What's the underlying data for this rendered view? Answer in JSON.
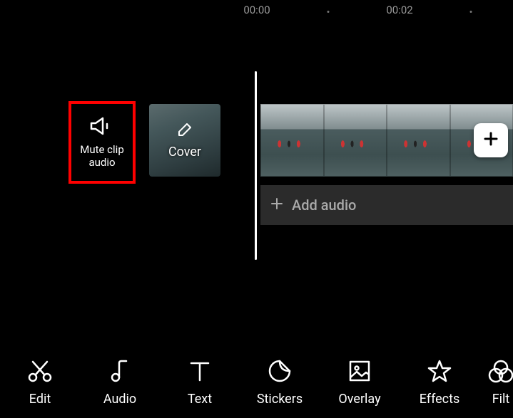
{
  "ruler": {
    "time1": "00:00",
    "time2": "00:02"
  },
  "timeline": {
    "mute_label_line1": "Mute clip",
    "mute_label_line2": "audio",
    "cover_label": "Cover",
    "add_audio_label": "Add audio"
  },
  "toolbar": {
    "edit": "Edit",
    "audio": "Audio",
    "text": "Text",
    "stickers": "Stickers",
    "overlay": "Overlay",
    "effects": "Effects",
    "filters": "Filt"
  }
}
